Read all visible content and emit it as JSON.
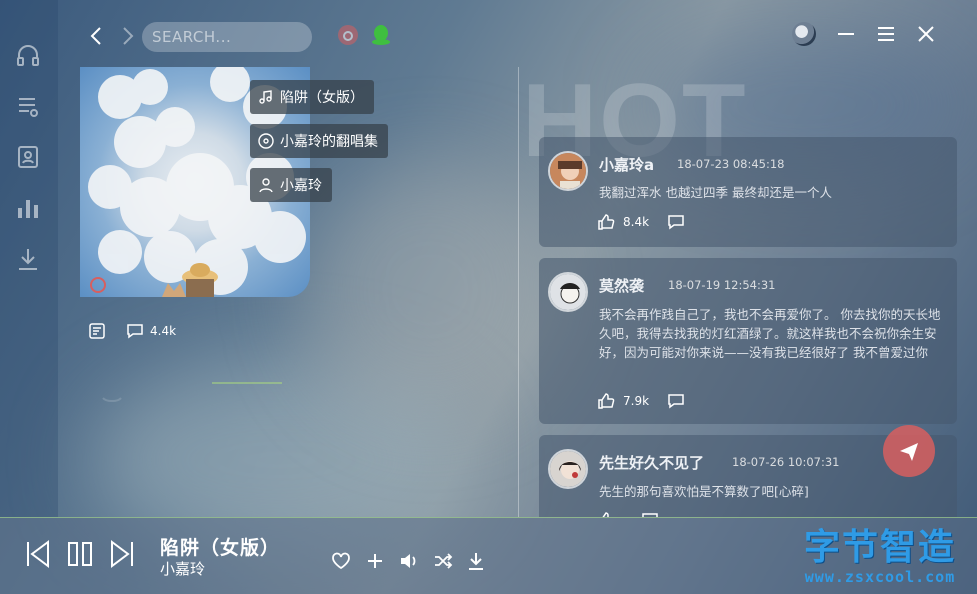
{
  "search": {
    "placeholder": "SEARCH..."
  },
  "sidebar": {
    "items": [
      {
        "icon": "headphones-icon"
      },
      {
        "icon": "playlist-icon"
      },
      {
        "icon": "profile-card-icon"
      },
      {
        "icon": "bar-chart-icon"
      },
      {
        "icon": "download-icon"
      }
    ]
  },
  "album": {
    "song_chip": "陷阱（女版）",
    "album_chip": "小嘉玲的翻唱集",
    "artist_chip": "小嘉玲",
    "comment_count": "4.4k"
  },
  "hot_label": "HOT",
  "comments": [
    {
      "name": "小嘉玲a",
      "time": "18-07-23 08:45:18",
      "text": "我翻过浑水 也越过四季 最终却还是一个人",
      "likes": "8.4k"
    },
    {
      "name": "莫然袭",
      "time": "18-07-19 12:54:31",
      "text": "我不会再作践自己了，我也不会再爱你了。 你去找你的天长地久吧，我得去找我的灯红酒绿了。就这样我也不会祝你余生安好，因为可能对你来说——没有我已经很好了 我不曾爱过你",
      "likes": "7.9k"
    },
    {
      "name": "先生好久不见了",
      "time": "18-07-26 10:07:31",
      "text": "先生的那句喜欢怕是不算数了吧[心碎]",
      "likes": ""
    }
  ],
  "player": {
    "title": "陷阱（女版）",
    "artist": "小嘉玲"
  },
  "brand": {
    "title": "字节智造",
    "url": "www.zsxcool.com"
  },
  "colors": {
    "brand_blue": "#2f9be6",
    "accent_red": "#d75f5f",
    "qq_green": "#3fbf3f",
    "progress_green": "#aadc8c"
  }
}
